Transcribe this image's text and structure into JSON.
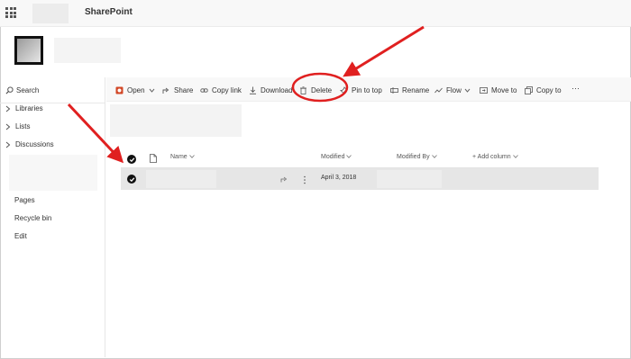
{
  "app_title": "SharePoint",
  "left_nav": {
    "search_label": "Search",
    "sections": [
      {
        "label": "Libraries"
      },
      {
        "label": "Lists"
      },
      {
        "label": "Discussions"
      }
    ],
    "links": [
      {
        "label": "Pages"
      },
      {
        "label": "Recycle bin"
      },
      {
        "label": "Edit"
      }
    ]
  },
  "command_bar": {
    "open": "Open",
    "share": "Share",
    "copy_link": "Copy link",
    "download": "Download",
    "delete": "Delete",
    "pin_to_top": "Pin to top",
    "rename": "Rename",
    "flow": "Flow",
    "move_to": "Move to",
    "copy_to": "Copy to",
    "more": "···"
  },
  "columns": {
    "name": "Name",
    "modified": "Modified",
    "modified_by": "Modified By",
    "add_column": "+ Add column"
  },
  "rows": [
    {
      "modified": "April 3, 2018",
      "selected": true
    }
  ],
  "colors": {
    "annotation": "#e02020",
    "office_red": "#d24726",
    "row_selected": "#e6e6e6"
  },
  "icons": [
    "app-launcher-icon",
    "search-icon",
    "chevron-right-icon",
    "office-icon",
    "share-icon",
    "link-icon",
    "download-icon",
    "trash-icon",
    "pin-icon",
    "rename-icon",
    "flow-icon",
    "move-icon",
    "copy-icon",
    "checkmark-icon",
    "document-icon",
    "ellipsis-icon"
  ]
}
